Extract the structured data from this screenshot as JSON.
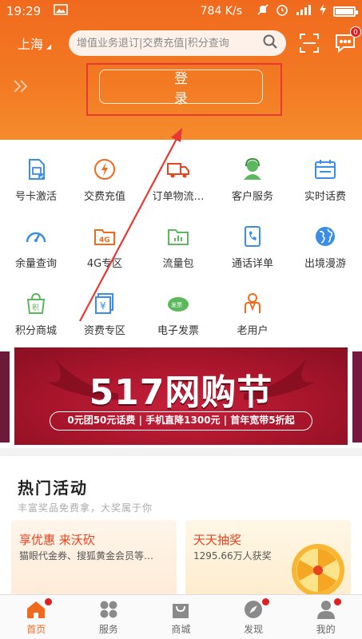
{
  "status": {
    "time": "19:29",
    "net_speed": "784 K/s"
  },
  "header": {
    "city": "上海",
    "search_placeholder": "增值业务退订|交费充值|积分查询",
    "msg_badge": "0",
    "login_label": "登录"
  },
  "grid": {
    "items": [
      {
        "label": "号卡激活",
        "icon": "sim-card-icon"
      },
      {
        "label": "交费充值",
        "icon": "lightning-icon"
      },
      {
        "label": "订单物流…",
        "icon": "truck-icon"
      },
      {
        "label": "客户服务",
        "icon": "service-agent-icon"
      },
      {
        "label": "实时话费",
        "icon": "calendar-icon"
      },
      {
        "label": "余量查询",
        "icon": "gauge-icon"
      },
      {
        "label": "4G专区",
        "icon": "4g-folder-icon"
      },
      {
        "label": "流量包",
        "icon": "chart-folder-icon"
      },
      {
        "label": "通话详单",
        "icon": "call-detail-icon"
      },
      {
        "label": "出境漫游",
        "icon": "globe-icon"
      },
      {
        "label": "积分商城",
        "icon": "shopping-bag-icon"
      },
      {
        "label": "资费专区",
        "icon": "yen-card-icon"
      },
      {
        "label": "电子发票",
        "icon": "invoice-icon"
      },
      {
        "label": "老用户",
        "icon": "old-user-icon"
      }
    ]
  },
  "banner": {
    "title": "517网购节",
    "subtitle": "0元团50元话费 | 手机直降1300元 | 首年宽带5折起"
  },
  "hot": {
    "title": "热门活动",
    "subtitle": "丰富奖品免费拿，大奖属于你",
    "cards": [
      {
        "title": "享优惠 来沃砍",
        "desc": "猫眼代金券、搜狐黄金会员等…"
      },
      {
        "title": "天天抽奖",
        "desc": "1295.66万人获奖"
      }
    ]
  },
  "tabs": [
    {
      "label": "首页",
      "icon": "home-icon",
      "active": true
    },
    {
      "label": "服务",
      "icon": "services-icon"
    },
    {
      "label": "商城",
      "icon": "shop-bag-icon"
    },
    {
      "label": "发现",
      "icon": "compass-icon"
    },
    {
      "label": "我的",
      "icon": "profile-icon"
    }
  ],
  "colors": {
    "brand": "#f06a1e",
    "highlight": "#e53935"
  }
}
